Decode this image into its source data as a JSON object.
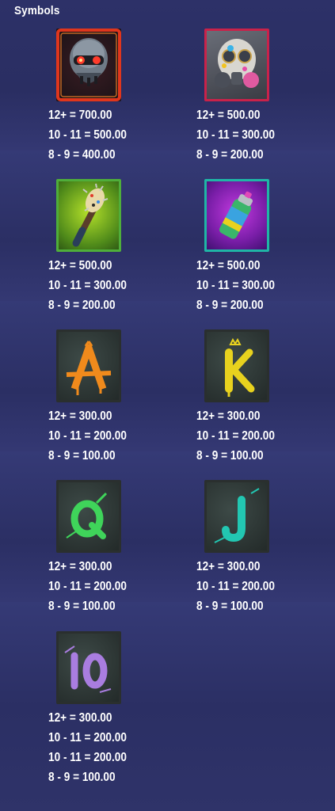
{
  "title": "Symbols",
  "symbols": [
    {
      "id": "robot-skull",
      "icon": "robot-skull-icon",
      "frame_color": "#d93a1a",
      "pays": [
        "12+ = 700.00",
        "10 - 11 = 500.00",
        "8 - 9 = 400.00"
      ]
    },
    {
      "id": "gas-mask",
      "icon": "gas-mask-icon",
      "frame_color": "#c9224a",
      "pays": [
        "12+ = 500.00",
        "10 - 11 = 300.00",
        "8 - 9 = 200.00"
      ]
    },
    {
      "id": "spiked-bat",
      "icon": "spiked-bat-icon",
      "frame_color": "#4fae3a",
      "pays": [
        "12+ = 500.00",
        "10 - 11 = 300.00",
        "8 - 9 = 200.00"
      ]
    },
    {
      "id": "spray-can",
      "icon": "spray-can-icon",
      "frame_color": "#1fb6a6",
      "pays": [
        "12+ = 500.00",
        "10 - 11 = 300.00",
        "8 - 9 = 200.00"
      ]
    },
    {
      "id": "A",
      "icon": "letter-a-icon",
      "frame_color": "#2a2f2e",
      "glyph": "A",
      "glyph_color": "#f08a1c",
      "pays": [
        "12+ = 300.00",
        "10 - 11 = 200.00",
        "8 - 9 = 100.00"
      ]
    },
    {
      "id": "K",
      "icon": "letter-k-icon",
      "frame_color": "#2a2f2e",
      "glyph": "K",
      "glyph_color": "#e8d21e",
      "pays": [
        "12+ = 300.00",
        "10 - 11 = 200.00",
        "8 - 9 = 100.00"
      ]
    },
    {
      "id": "Q",
      "icon": "letter-q-icon",
      "frame_color": "#2a2f2e",
      "glyph": "Q",
      "glyph_color": "#3fd45a",
      "pays": [
        "12+ = 300.00",
        "10 - 11 = 200.00",
        "8 - 9 = 100.00"
      ]
    },
    {
      "id": "J",
      "icon": "letter-j-icon",
      "frame_color": "#2a2f2e",
      "glyph": "J",
      "glyph_color": "#22c7b2",
      "pays": [
        "12+ = 300.00",
        "10 - 11 = 200.00",
        "8 - 9 = 100.00"
      ]
    },
    {
      "id": "10",
      "icon": "number-ten-icon",
      "frame_color": "#2a2f2e",
      "glyph": "10",
      "glyph_color": "#a97de0",
      "pays": [
        "12+ = 300.00",
        "10 - 11 = 200.00",
        "10 - 11 = 200.00",
        "8 - 9 = 100.00"
      ]
    }
  ]
}
